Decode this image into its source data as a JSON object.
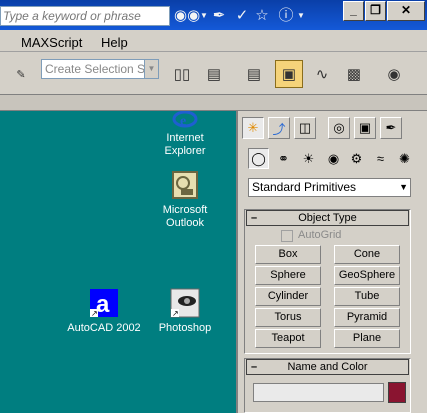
{
  "titlebar": {
    "search_placeholder": "Type a keyword or phrase",
    "icons": [
      "binoculars-icon",
      "wrench-icon",
      "star-icon",
      "help-icon"
    ],
    "window_buttons": [
      "minimize",
      "restore",
      "close"
    ]
  },
  "menu": {
    "items": [
      "MAXScript",
      "Help"
    ]
  },
  "toolbar": {
    "selection_set_placeholder": "Create Selection Se"
  },
  "desktop": {
    "background": "#007e80",
    "icons": [
      {
        "label_line1": "Internet",
        "label_line2": "Explorer"
      },
      {
        "label_line1": "Microsoft",
        "label_line2": "Outlook"
      },
      {
        "label_line1": "AutoCAD 2002",
        "label_line2": ""
      },
      {
        "label_line1": "Photoshop",
        "label_line2": ""
      }
    ]
  },
  "panel": {
    "category_dropdown": "Standard Primitives",
    "object_type_title": "Object Type",
    "autogrid_label": "AutoGrid",
    "object_buttons": [
      "Box",
      "Cone",
      "Sphere",
      "GeoSphere",
      "Cylinder",
      "Tube",
      "Torus",
      "Pyramid",
      "Teapot",
      "Plane"
    ],
    "name_color_title": "Name and Color",
    "color_swatch": "#8a1430",
    "collapse_symbol": "–"
  }
}
